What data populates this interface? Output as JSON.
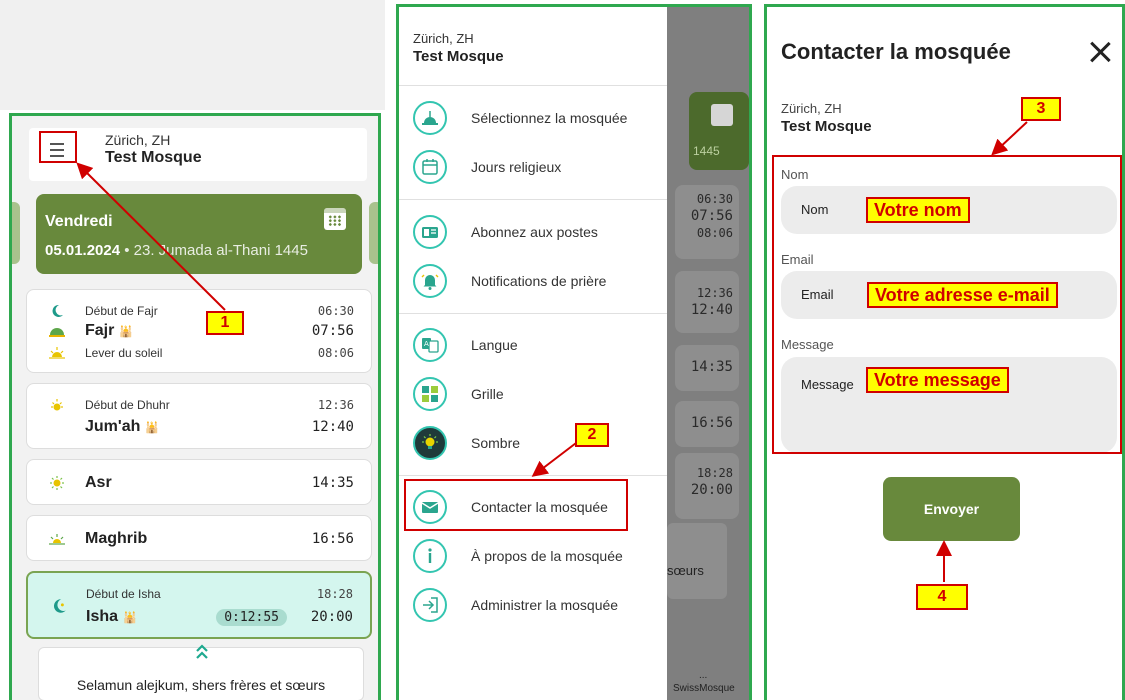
{
  "colors": {
    "panel_border": "#2fa84f",
    "primary_green": "#68893c",
    "teal_accent": "#33c5b0",
    "annotation_red": "#d00000",
    "annotation_yellow": "#ffff00",
    "active_card_bg": "#d4f6ee"
  },
  "home": {
    "header": {
      "city": "Zürich, ZH",
      "mosque": "Test Mosque",
      "menu_icon": "hamburger-menu-icon"
    },
    "date_card": {
      "day": "Vendredi",
      "date": "05.01.2024",
      "hijri": " • 23. Jumada al-Thani 1445",
      "icon": "calendar-grid-icon"
    },
    "prayers": {
      "fajr": {
        "start_label": "Début de Fajr",
        "start_time": "06:30",
        "name": "Fajr",
        "time": "07:56",
        "sunrise_label": "Lever du soleil",
        "sunrise_time": "08:06"
      },
      "dhuhr": {
        "start_label": "Début de Dhuhr",
        "start_time": "12:36",
        "name": "Jum'ah",
        "time": "12:40"
      },
      "asr": {
        "name": "Asr",
        "time": "14:35"
      },
      "maghrib": {
        "name": "Maghrib",
        "time": "16:56"
      },
      "isha": {
        "start_label": "Début de Isha",
        "start_time": "18:28",
        "name": "Isha",
        "countdown": "0:12:55",
        "time": "20:00"
      }
    },
    "footer_message": "Selamun alejkum, shers frères et sœurs"
  },
  "drawer": {
    "city": "Zürich, ZH",
    "mosque": "Test Mosque",
    "items": [
      {
        "label": "Sélectionnez la mosquée",
        "icon": "mosque-dome-icon"
      },
      {
        "label": "Jours religieux",
        "icon": "calendar-icon"
      },
      {
        "label": "Abonnez aux postes",
        "icon": "subscribe-card-icon"
      },
      {
        "label": "Notifications de prière",
        "icon": "bell-icon"
      },
      {
        "label": "Langue",
        "icon": "translate-icon"
      },
      {
        "label": "Grille",
        "icon": "grid-icon"
      },
      {
        "label": "Sombre",
        "icon": "lightbulb-icon"
      },
      {
        "label": "Contacter la mosquée",
        "icon": "envelope-icon"
      },
      {
        "label": "À propos de la mosquée",
        "icon": "info-icon"
      },
      {
        "label": "Administrer la mosquée",
        "icon": "login-arrow-icon"
      }
    ],
    "background": {
      "times": [
        "06:30",
        "07:56",
        "08:06",
        "12:36",
        "12:40",
        "14:35",
        "16:56",
        "18:28",
        "20:00"
      ],
      "year_fragment": "1445",
      "footer_fragment": "sœurs",
      "bottom_dots": "...",
      "bottom_label": "SwissMosque"
    }
  },
  "contact": {
    "title": "Contacter la mosquée",
    "city": "Zürich, ZH",
    "mosque": "Test Mosque",
    "fields": {
      "name": {
        "label": "Nom",
        "placeholder": "Nom"
      },
      "email": {
        "label": "Email",
        "placeholder": "Email"
      },
      "message": {
        "label": "Message",
        "placeholder": "Message"
      }
    },
    "send_label": "Envoyer"
  },
  "annotations": {
    "steps": [
      "1",
      "2",
      "3",
      "4"
    ],
    "name_hint": "Votre nom",
    "email_hint": "Votre adresse e-mail",
    "message_hint": "Votre message"
  }
}
